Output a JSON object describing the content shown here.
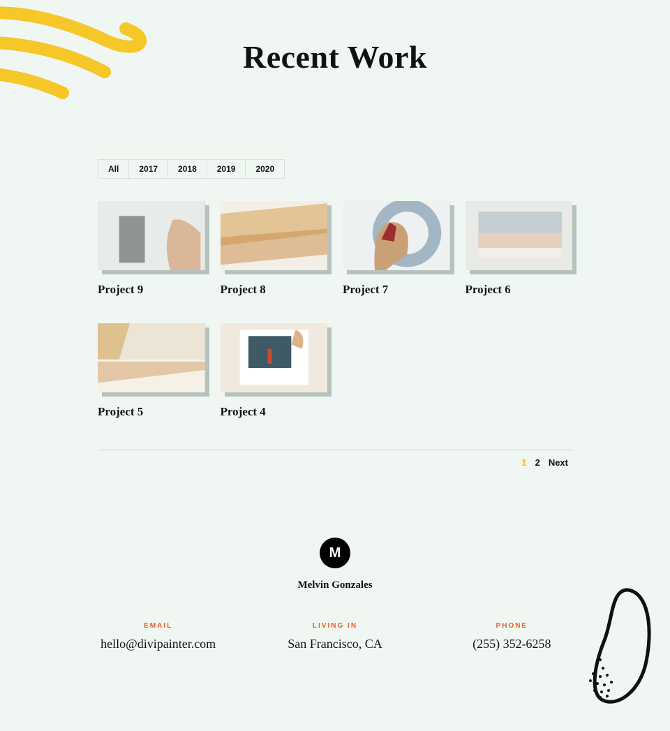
{
  "heading": "Recent Work",
  "filters": [
    "All",
    "2017",
    "2018",
    "2019",
    "2020"
  ],
  "projects": [
    {
      "title": "Project 9"
    },
    {
      "title": "Project 8"
    },
    {
      "title": "Project 7"
    },
    {
      "title": "Project 6"
    },
    {
      "title": "Project 5"
    },
    {
      "title": "Project 4"
    }
  ],
  "pagination": {
    "pages": [
      "1",
      "2"
    ],
    "current": "1",
    "next_label": "Next"
  },
  "footer": {
    "logo_letter": "M",
    "author": "Melvin Gonzales",
    "contacts": [
      {
        "label": "Email",
        "value": "hello@divipainter.com"
      },
      {
        "label": "Living In",
        "value": "San Francisco, CA"
      },
      {
        "label": "Phone",
        "value": "(255) 352-6258"
      }
    ]
  },
  "thumb_svgs": [
    "<rect width='100' height='65' fill='#e8ece9'/><rect x='20' y='14' width='24' height='44' fill='#8f9492'/><path d='M70 18 Q80 14 96 30 L96 65 L68 65 Q60 40 70 18' fill='#d9b798'/>",
    "<rect width='100' height='65' fill='#f3eee6'/><path d='M0 12 L100 2 L100 30 L0 42 Z' fill='#d7a960' opacity='.6'/><path d='M0 34 L100 26 L100 50 L0 60 Z' fill='#c88a46' opacity='.5'/>",
    "<rect width='100' height='65' fill='#eef1f1'/><circle cx='60' cy='30' r='26' fill='none' stroke='#6f8fa6' stroke-width='12' opacity='.6'/><path d='M36 26 q8 -10 18 -4 q10 6 6 28 L40 65 L30 65 q-2 -28 6 -39' fill='#caa176'/><path d='M36 36 l8 -16 l6 4 l-2 14 z' fill='#9a2d2d'/>",
    "<rect width='100' height='65' fill='#e7eae6'/><rect x='12' y='10' width='78' height='44' fill='#f4efe6'/><rect x='12' y='10' width='78' height='20' fill='#9fb3c3' opacity='.55'/><rect x='12' y='30' width='78' height='14' fill='#d6b89b' opacity='.55'/>",
    "<rect width='100' height='65' fill='#ece4d5'/><rect x='0' y='34' width='100' height='31' fill='#f6f1e7'/><path d='M0 0 L30 0 L20 34 L0 34 Z' fill='#d7a960' opacity='.6'/><path d='M0 36 L100 36 L100 44 L0 56 Z' fill='#c88a46' opacity='.4'/>",
    "<rect width='100' height='65' fill='#efe9de'/><rect x='18' y='6' width='64' height='52' fill='#fff'/><rect x='26' y='12' width='40' height='30' fill='#3e5a66'/><path d='M70 6 q10 4 6 18 l-10 -4 z' fill='#dcb38a'/><rect x='44' y='24' width='4' height='14' fill='#c94b2a'/>"
  ]
}
